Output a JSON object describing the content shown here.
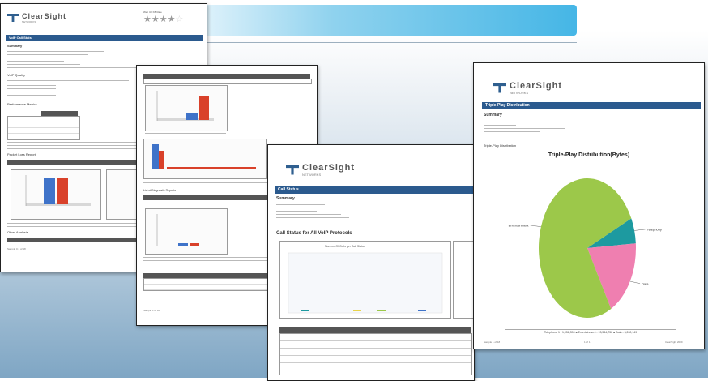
{
  "brand": {
    "name": "ClearSight",
    "sub": "NETWORKS"
  },
  "rating": {
    "label": "Web Url KB Rate",
    "stars_filled": 4,
    "stars_total": 5
  },
  "doc1": {
    "title_bar": "VoIP Call Stats",
    "summary_label": "Summary",
    "section_quality": "VoIP Quality",
    "section_perf": "Performance Metrics",
    "section_charts": "Packet Loss Report",
    "section_other": "Other Analysis",
    "footer": "Sample 0.1 of 18"
  },
  "doc2": {
    "footer": "Sample 1 of 18",
    "section": "List of Diagnostic Reports"
  },
  "doc3": {
    "title_bar": "Call Status",
    "summary_label": "Summary",
    "section": "Call Status for All VoIP Protocols",
    "chart_title": "Number Of Calls per Call Status"
  },
  "doc4": {
    "title_bar": "Triple-Play Distribution",
    "summary_label": "Summary",
    "section": "Triple-Play Distribution",
    "chart_title": "Triple-Play Distribution(Bytes)",
    "legend_text": "Telephone 1 - 1,056,394  ■ Entertainment - 13,564,736  ■ Data - 3,200,149",
    "footer_left": "Sample 1 of 18",
    "footer_mid": "1 of 1",
    "footer_right": "ClearSight 2009"
  },
  "chart_data": [
    {
      "type": "pie",
      "title": "Triple-Play Distribution(Bytes)",
      "categories": [
        "Entertainment",
        "Telephony",
        "Data"
      ],
      "values": [
        13564736,
        1056394,
        3200149
      ],
      "colors": [
        "#9cc84a",
        "#1d9aa0",
        "#ef7fb0"
      ]
    }
  ]
}
